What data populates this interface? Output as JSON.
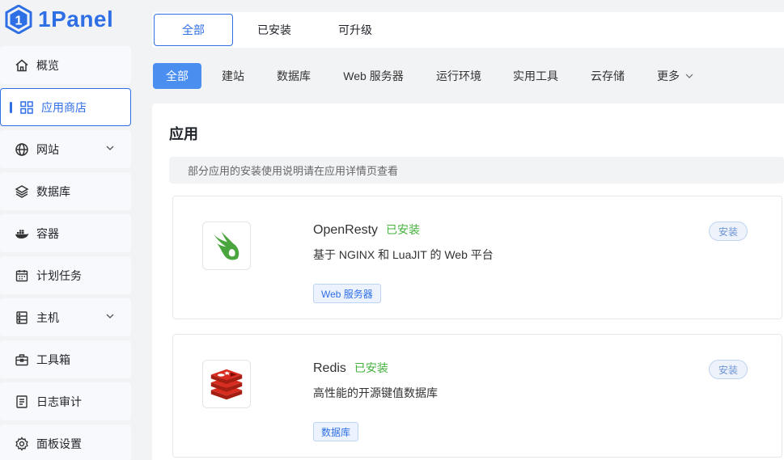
{
  "brand": {
    "logo_text": "1Panel",
    "accent": "#2f6fe6"
  },
  "sidebar": {
    "items": [
      {
        "label": "概览",
        "icon": "home-icon"
      },
      {
        "label": "应用商店",
        "icon": "app-grid-icon",
        "active": true
      },
      {
        "label": "网站",
        "icon": "globe-icon",
        "expandable": true
      },
      {
        "label": "数据库",
        "icon": "layers-icon"
      },
      {
        "label": "容器",
        "icon": "docker-icon"
      },
      {
        "label": "计划任务",
        "icon": "calendar-icon"
      },
      {
        "label": "主机",
        "icon": "server-icon",
        "expandable": true
      },
      {
        "label": "工具箱",
        "icon": "toolbox-icon"
      },
      {
        "label": "日志审计",
        "icon": "log-icon"
      },
      {
        "label": "面板设置",
        "icon": "gear-icon"
      }
    ]
  },
  "top_tabs": [
    {
      "label": "全部",
      "active": true
    },
    {
      "label": "已安装"
    },
    {
      "label": "可升级"
    }
  ],
  "categories": [
    {
      "label": "全部",
      "active": true
    },
    {
      "label": "建站"
    },
    {
      "label": "数据库"
    },
    {
      "label": "Web 服务器"
    },
    {
      "label": "运行环境"
    },
    {
      "label": "实用工具"
    },
    {
      "label": "云存储"
    },
    {
      "label": "更多"
    }
  ],
  "main": {
    "title": "应用",
    "notice": "部分应用的安装使用说明请在应用详情页查看",
    "apps": [
      {
        "name": "OpenResty",
        "status": "已安装",
        "description": "基于 NGINX 和 LuaJIT 的 Web 平台",
        "tag": "Web 服务器",
        "action": "安装"
      },
      {
        "name": "Redis",
        "status": "已安装",
        "description": "高性能的开源键值数据库",
        "tag": "数据库",
        "action": "安装"
      }
    ]
  }
}
